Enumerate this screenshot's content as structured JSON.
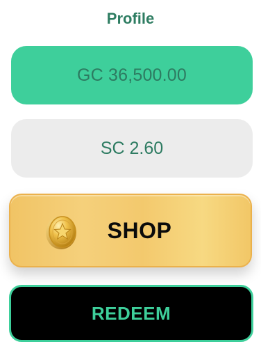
{
  "header": {
    "title": "Profile"
  },
  "balances": {
    "gc": "GC 36,500.00",
    "sc": "SC 2.60"
  },
  "actions": {
    "shop_label": "SHOP",
    "redeem_label": "REDEEM"
  },
  "colors": {
    "accent_green": "#3ecf9b",
    "text_green": "#2d7b61",
    "gold": "#f3c96d",
    "panel_gray": "#ececec"
  },
  "icons": {
    "shop": "coin-star-icon"
  }
}
